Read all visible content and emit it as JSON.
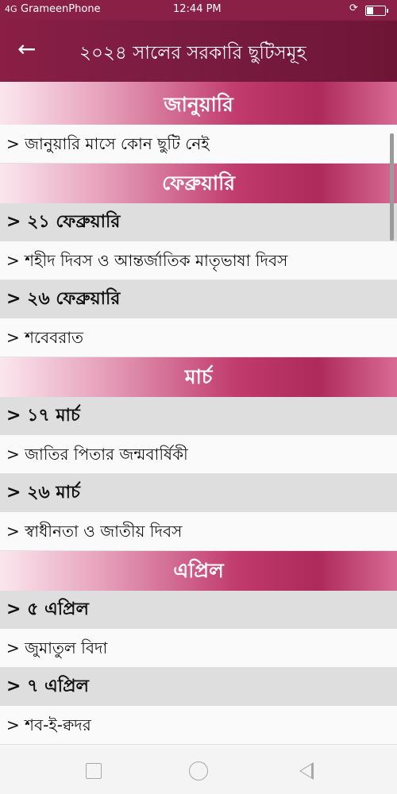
{
  "status_bar": {
    "signal": "4G",
    "carrier": "GrameenPhone",
    "time": "12:44 PM",
    "rotation_icon": "screen-rotation-icon",
    "battery_icon": "battery-icon"
  },
  "app_bar": {
    "back_icon": "arrow-left-icon",
    "title": "২০২৪ সালের সরকারি ছুটিসমূহ"
  },
  "months": [
    {
      "name": "জানুয়ারি",
      "entries": [
        {
          "date": null,
          "holiday": "> জানুয়ারি মাসে কোন ছুটি নেই"
        }
      ]
    },
    {
      "name": "ফেব্রুয়ারি",
      "entries": [
        {
          "date": "> ২১ ফেব্রুয়ারি",
          "holiday": "> শহীদ দিবস ও আন্তর্জাতিক মাতৃভাষা দিবস"
        },
        {
          "date": "> ২৬ ফেব্রুয়ারি",
          "holiday": "> শবেবরাত"
        }
      ]
    },
    {
      "name": "মার্চ",
      "entries": [
        {
          "date": "> ১৭ মার্চ",
          "holiday": "> জাতির পিতার জন্মবার্ষিকী"
        },
        {
          "date": "> ২৬ মার্চ",
          "holiday": "> স্বাধীনতা ও জাতীয় দিবস"
        }
      ]
    },
    {
      "name": "এপ্রিল",
      "entries": [
        {
          "date": "> ৫ এপ্রিল",
          "holiday": "> জুমাতুল বিদা"
        },
        {
          "date": "> ৭ এপ্রিল",
          "holiday": "> শব-ই-ক্বদর"
        }
      ]
    }
  ],
  "nav_bar": {
    "recents_icon": "square-icon",
    "home_icon": "circle-icon",
    "back_icon": "triangle-back-icon"
  },
  "colors": {
    "primary": "#7a1c40",
    "month_accent": "#c03a6b",
    "date_row": "#dedede"
  }
}
